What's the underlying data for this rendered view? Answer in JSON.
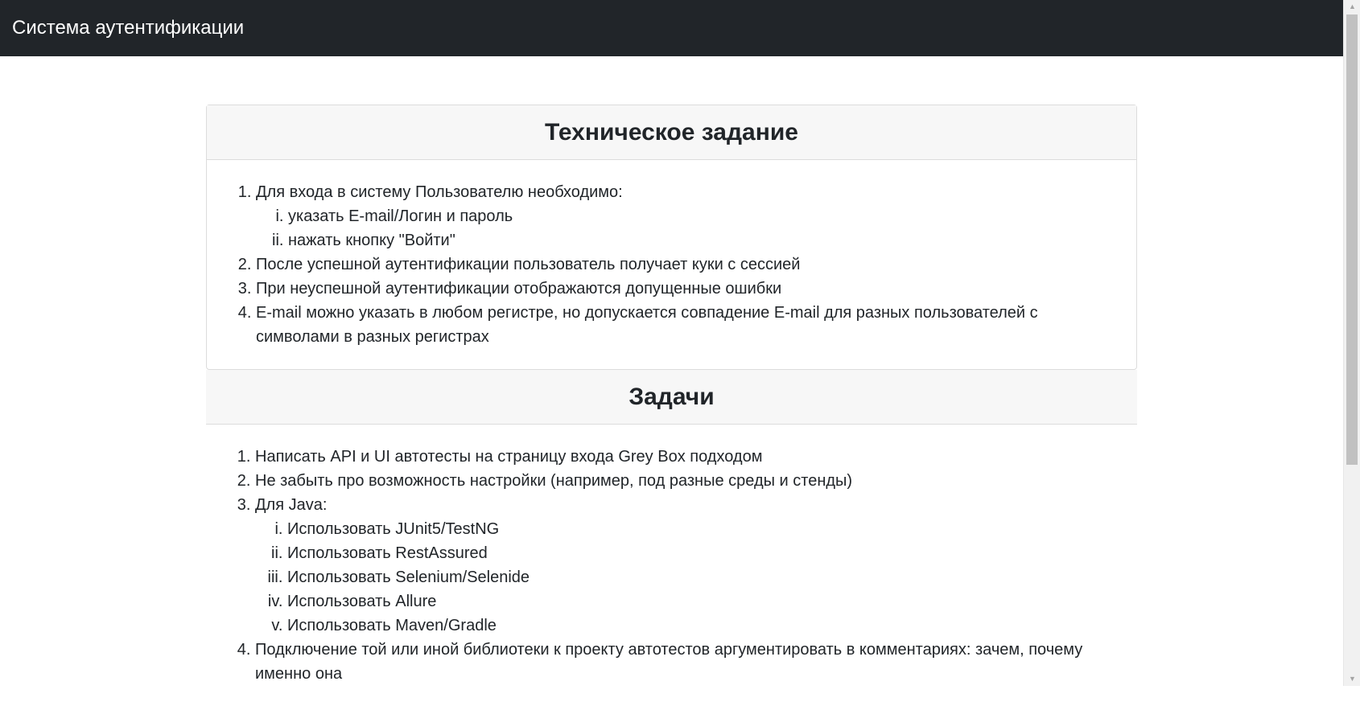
{
  "navbar": {
    "brand": "Система аутентификации"
  },
  "spec": {
    "title": "Техническое задание",
    "item1": {
      "text": "Для входа в систему Пользователю необходимо:",
      "sub": [
        "указать E-mail/Логин и пароль",
        "нажать кнопку \"Войти\""
      ]
    },
    "item2": "После успешной аутентификации пользователь получает куки с сессией",
    "item3": "При неуспешной аутентификации отображаются допущенные ошибки",
    "item4": "E-mail можно указать в любом регистре, но допускается совпадение E-mail для разных пользователей с символами в разных регистрах"
  },
  "tasks": {
    "title": "Задачи",
    "item1": "Написать API и UI автотесты на страницу входа Grey Box подходом",
    "item2": "Не забыть про возможность настройки (например, под разные среды и стенды)",
    "item3": {
      "text": "Для Java:",
      "sub": [
        "Использовать JUnit5/TestNG",
        "Использовать RestAssured",
        "Использовать Selenium/Selenide",
        "Использовать Allure",
        "Использовать Maven/Gradle"
      ]
    },
    "item4": "Подключение той или иной библиотеки к проекту автотестов аргументировать в комментариях: зачем, почему именно она"
  }
}
